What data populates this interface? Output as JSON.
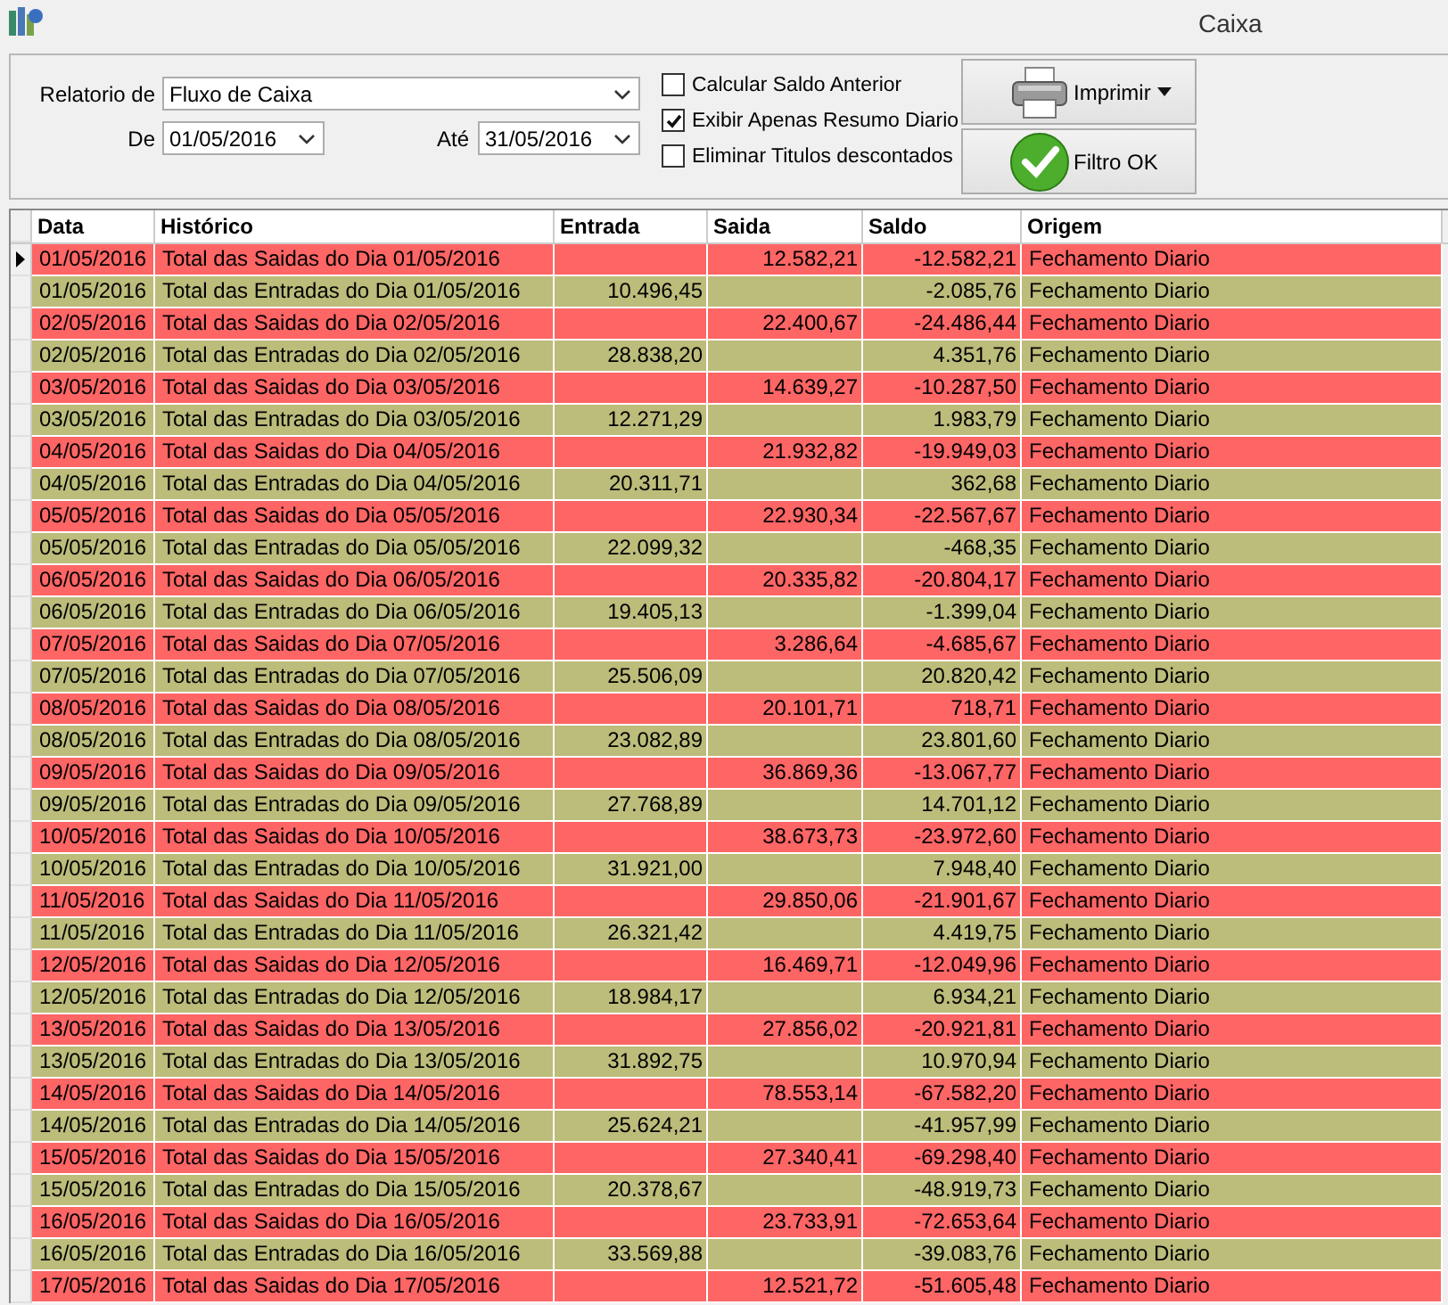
{
  "window": {
    "title": "Caixa"
  },
  "filters": {
    "report": {
      "label": "Relatorio de",
      "value": "Fluxo de Caixa"
    },
    "from": {
      "label": "De",
      "value": "01/05/2016"
    },
    "to": {
      "label": "Até",
      "value": "31/05/2016"
    }
  },
  "options": [
    {
      "label": "Calcular Saldo Anterior",
      "checked": false
    },
    {
      "label": "Exibir Apenas Resumo Diario",
      "checked": true
    },
    {
      "label": "Eliminar Titulos descontados",
      "checked": false
    }
  ],
  "buttons": [
    {
      "label": "Imprimir",
      "kind": "print"
    },
    {
      "label": "Filtro OK",
      "kind": "filter"
    }
  ],
  "table": {
    "columns": [
      {
        "label": "Data"
      },
      {
        "label": "Histórico"
      },
      {
        "label": "Entrada"
      },
      {
        "label": "Saida"
      },
      {
        "label": "Saldo"
      },
      {
        "label": "Origem"
      }
    ],
    "rows": [
      {
        "kind": "saida",
        "selected": true,
        "data": "01/05/2016",
        "historico": "Total das Saidas do Dia 01/05/2016",
        "saida": "12.582,21",
        "saldo": "-12.582,21",
        "origem": "Fechamento Diario"
      },
      {
        "kind": "entrada",
        "selected": false,
        "data": "01/05/2016",
        "historico": "Total das Entradas do Dia 01/05/2016",
        "entrada": "10.496,45",
        "saldo": "-2.085,76",
        "origem": "Fechamento Diario"
      },
      {
        "kind": "saida",
        "selected": false,
        "data": "02/05/2016",
        "historico": "Total das Saidas do Dia 02/05/2016",
        "saida": "22.400,67",
        "saldo": "-24.486,44",
        "origem": "Fechamento Diario"
      },
      {
        "kind": "entrada",
        "selected": false,
        "data": "02/05/2016",
        "historico": "Total das Entradas do Dia 02/05/2016",
        "entrada": "28.838,20",
        "saldo": "4.351,76",
        "origem": "Fechamento Diario"
      },
      {
        "kind": "saida",
        "selected": false,
        "data": "03/05/2016",
        "historico": "Total das Saidas do Dia 03/05/2016",
        "saida": "14.639,27",
        "saldo": "-10.287,50",
        "origem": "Fechamento Diario"
      },
      {
        "kind": "entrada",
        "selected": false,
        "data": "03/05/2016",
        "historico": "Total das Entradas do Dia 03/05/2016",
        "entrada": "12.271,29",
        "saldo": "1.983,79",
        "origem": "Fechamento Diario"
      },
      {
        "kind": "saida",
        "selected": false,
        "data": "04/05/2016",
        "historico": "Total das Saidas do Dia 04/05/2016",
        "saida": "21.932,82",
        "saldo": "-19.949,03",
        "origem": "Fechamento Diario"
      },
      {
        "kind": "entrada",
        "selected": false,
        "data": "04/05/2016",
        "historico": "Total das Entradas do Dia 04/05/2016",
        "entrada": "20.311,71",
        "saldo": "362,68",
        "origem": "Fechamento Diario"
      },
      {
        "kind": "saida",
        "selected": false,
        "data": "05/05/2016",
        "historico": "Total das Saidas do Dia 05/05/2016",
        "saida": "22.930,34",
        "saldo": "-22.567,67",
        "origem": "Fechamento Diario"
      },
      {
        "kind": "entrada",
        "selected": false,
        "data": "05/05/2016",
        "historico": "Total das Entradas do Dia 05/05/2016",
        "entrada": "22.099,32",
        "saldo": "-468,35",
        "origem": "Fechamento Diario"
      },
      {
        "kind": "saida",
        "selected": false,
        "data": "06/05/2016",
        "historico": "Total das Saidas do Dia 06/05/2016",
        "saida": "20.335,82",
        "saldo": "-20.804,17",
        "origem": "Fechamento Diario"
      },
      {
        "kind": "entrada",
        "selected": false,
        "data": "06/05/2016",
        "historico": "Total das Entradas do Dia 06/05/2016",
        "entrada": "19.405,13",
        "saldo": "-1.399,04",
        "origem": "Fechamento Diario"
      },
      {
        "kind": "saida",
        "selected": false,
        "data": "07/05/2016",
        "historico": "Total das Saidas do Dia 07/05/2016",
        "saida": "3.286,64",
        "saldo": "-4.685,67",
        "origem": "Fechamento Diario"
      },
      {
        "kind": "entrada",
        "selected": false,
        "data": "07/05/2016",
        "historico": "Total das Entradas do Dia 07/05/2016",
        "entrada": "25.506,09",
        "saldo": "20.820,42",
        "origem": "Fechamento Diario"
      },
      {
        "kind": "saida",
        "selected": false,
        "data": "08/05/2016",
        "historico": "Total das Saidas do Dia 08/05/2016",
        "saida": "20.101,71",
        "saldo": "718,71",
        "origem": "Fechamento Diario"
      },
      {
        "kind": "entrada",
        "selected": false,
        "data": "08/05/2016",
        "historico": "Total das Entradas do Dia 08/05/2016",
        "entrada": "23.082,89",
        "saldo": "23.801,60",
        "origem": "Fechamento Diario"
      },
      {
        "kind": "saida",
        "selected": false,
        "data": "09/05/2016",
        "historico": "Total das Saidas do Dia 09/05/2016",
        "saida": "36.869,36",
        "saldo": "-13.067,77",
        "origem": "Fechamento Diario"
      },
      {
        "kind": "entrada",
        "selected": false,
        "data": "09/05/2016",
        "historico": "Total das Entradas do Dia 09/05/2016",
        "entrada": "27.768,89",
        "saldo": "14.701,12",
        "origem": "Fechamento Diario"
      },
      {
        "kind": "saida",
        "selected": false,
        "data": "10/05/2016",
        "historico": "Total das Saidas do Dia 10/05/2016",
        "saida": "38.673,73",
        "saldo": "-23.972,60",
        "origem": "Fechamento Diario"
      },
      {
        "kind": "entrada",
        "selected": false,
        "data": "10/05/2016",
        "historico": "Total das Entradas do Dia 10/05/2016",
        "entrada": "31.921,00",
        "saldo": "7.948,40",
        "origem": "Fechamento Diario"
      },
      {
        "kind": "saida",
        "selected": false,
        "data": "11/05/2016",
        "historico": "Total das Saidas do Dia 11/05/2016",
        "saida": "29.850,06",
        "saldo": "-21.901,67",
        "origem": "Fechamento Diario"
      },
      {
        "kind": "entrada",
        "selected": false,
        "data": "11/05/2016",
        "historico": "Total das Entradas do Dia 11/05/2016",
        "entrada": "26.321,42",
        "saldo": "4.419,75",
        "origem": "Fechamento Diario"
      },
      {
        "kind": "saida",
        "selected": false,
        "data": "12/05/2016",
        "historico": "Total das Saidas do Dia 12/05/2016",
        "saida": "16.469,71",
        "saldo": "-12.049,96",
        "origem": "Fechamento Diario"
      },
      {
        "kind": "entrada",
        "selected": false,
        "data": "12/05/2016",
        "historico": "Total das Entradas do Dia 12/05/2016",
        "entrada": "18.984,17",
        "saldo": "6.934,21",
        "origem": "Fechamento Diario"
      },
      {
        "kind": "saida",
        "selected": false,
        "data": "13/05/2016",
        "historico": "Total das Saidas do Dia 13/05/2016",
        "saida": "27.856,02",
        "saldo": "-20.921,81",
        "origem": "Fechamento Diario"
      },
      {
        "kind": "entrada",
        "selected": false,
        "data": "13/05/2016",
        "historico": "Total das Entradas do Dia 13/05/2016",
        "entrada": "31.892,75",
        "saldo": "10.970,94",
        "origem": "Fechamento Diario"
      },
      {
        "kind": "saida",
        "selected": false,
        "data": "14/05/2016",
        "historico": "Total das Saidas do Dia 14/05/2016",
        "saida": "78.553,14",
        "saldo": "-67.582,20",
        "origem": "Fechamento Diario"
      },
      {
        "kind": "entrada",
        "selected": false,
        "data": "14/05/2016",
        "historico": "Total das Entradas do Dia 14/05/2016",
        "entrada": "25.624,21",
        "saldo": "-41.957,99",
        "origem": "Fechamento Diario"
      },
      {
        "kind": "saida",
        "selected": false,
        "data": "15/05/2016",
        "historico": "Total das Saidas do Dia 15/05/2016",
        "saida": "27.340,41",
        "saldo": "-69.298,40",
        "origem": "Fechamento Diario"
      },
      {
        "kind": "entrada",
        "selected": false,
        "data": "15/05/2016",
        "historico": "Total das Entradas do Dia 15/05/2016",
        "entrada": "20.378,67",
        "saldo": "-48.919,73",
        "origem": "Fechamento Diario"
      },
      {
        "kind": "saida",
        "selected": false,
        "data": "16/05/2016",
        "historico": "Total das Saidas do Dia 16/05/2016",
        "saida": "23.733,91",
        "saldo": "-72.653,64",
        "origem": "Fechamento Diario"
      },
      {
        "kind": "entrada",
        "selected": false,
        "data": "16/05/2016",
        "historico": "Total das Entradas do Dia 16/05/2016",
        "entrada": "33.569,88",
        "saldo": "-39.083,76",
        "origem": "Fechamento Diario"
      },
      {
        "kind": "saida",
        "selected": false,
        "data": "17/05/2016",
        "historico": "Total das Saidas do Dia 17/05/2016",
        "saida": "12.521,72",
        "saldo": "-51.605,48",
        "origem": "Fechamento Diario"
      }
    ]
  }
}
